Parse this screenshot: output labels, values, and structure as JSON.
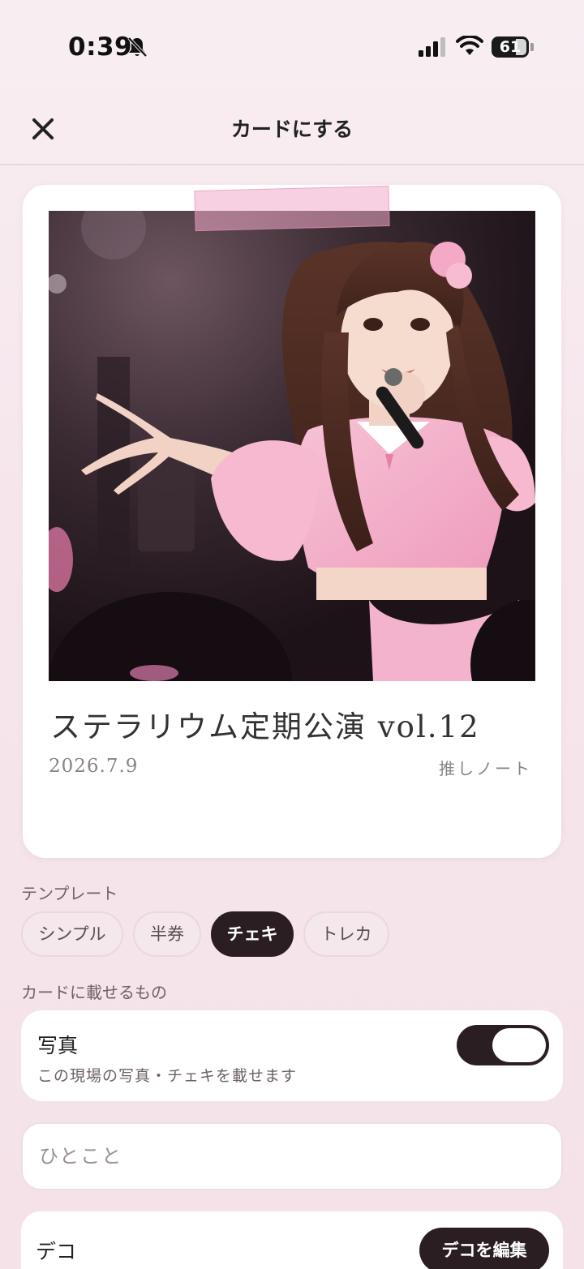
{
  "status_bar": {
    "time": "0:39",
    "battery": "61",
    "icons": [
      "bell-slash-icon",
      "cellular-signal-icon",
      "wifi-icon",
      "battery-icon"
    ]
  },
  "nav": {
    "title": "カードにする",
    "close_icon": "close-icon"
  },
  "card": {
    "title": "ステラリウム定期公演 vol.12",
    "date": "2026.7.9",
    "brand": "推しノート",
    "colors": {
      "tape": "#f3a9c8",
      "outfit_pink": "#f2a6c4",
      "stage": "#2a1a22"
    }
  },
  "template": {
    "label": "テンプレート",
    "options": [
      "シンプル",
      "半券",
      "チェキ",
      "トレカ"
    ],
    "selected": "チェキ"
  },
  "contents": {
    "label": "カードに載せるもの",
    "photo_title": "写真",
    "photo_desc": "この現場の写真・チェキを載せます",
    "photo_enabled": true
  },
  "comment": {
    "placeholder": "ひとこと",
    "value": ""
  },
  "deco": {
    "title": "デコ",
    "button": "デコを編集"
  },
  "colors": {
    "accent_dark": "#2b1e22",
    "background": "#f6e6ec"
  }
}
